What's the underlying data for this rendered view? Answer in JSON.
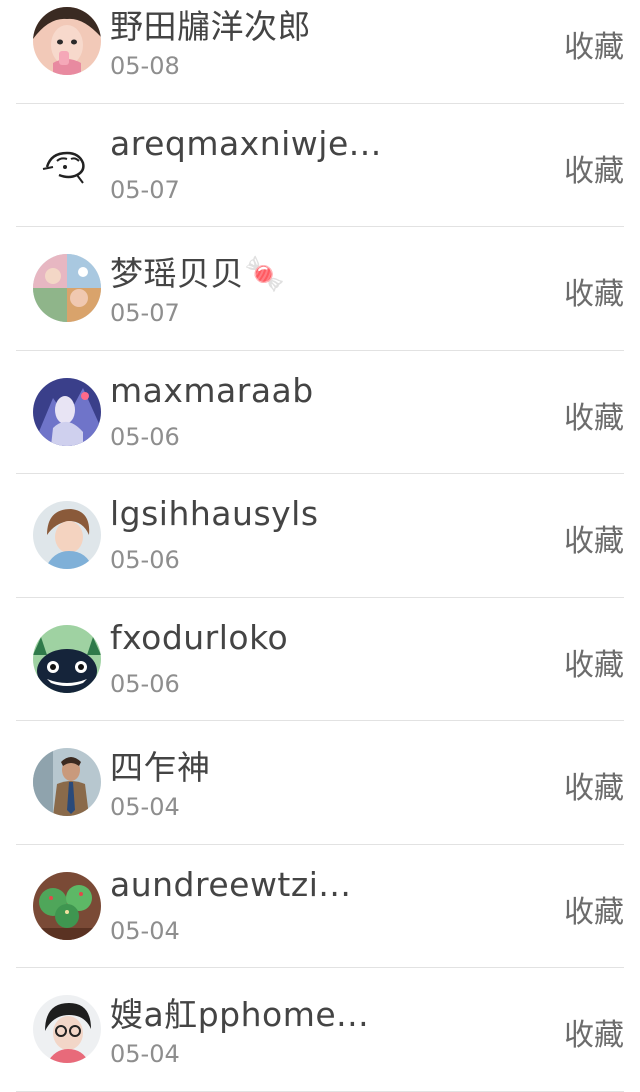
{
  "colors": {
    "name": "#444444",
    "date": "#8e8e8e",
    "action": "#6c6c6c",
    "divider": "#e2e2e2"
  },
  "follow_list": [
    {
      "name": "野田牖洋次郎",
      "date": "05-08",
      "action": "收藏",
      "avatar": "girl-photo-avatar"
    },
    {
      "name": "areqmaxniwje...",
      "date": "05-07",
      "action": "收藏",
      "avatar": "sketch-avatar"
    },
    {
      "name": "梦瑶贝贝🍬",
      "date": "05-07",
      "action": "收藏",
      "avatar": "colorful-collage-avatar"
    },
    {
      "name": "maxmaraab",
      "date": "05-06",
      "action": "收藏",
      "avatar": "anime-art-avatar"
    },
    {
      "name": "lgsihhausyls",
      "date": "05-06",
      "action": "收藏",
      "avatar": "boy-photo-avatar"
    },
    {
      "name": "fxodurloko",
      "date": "05-06",
      "action": "收藏",
      "avatar": "totoro-avatar"
    },
    {
      "name": "四乍神",
      "date": "05-04",
      "action": "收藏",
      "avatar": "man-in-suit-avatar"
    },
    {
      "name": "aundreewtzi...",
      "date": "05-04",
      "action": "收藏",
      "avatar": "cupcake-avatar"
    },
    {
      "name": "嫂a舡pphome...",
      "date": "05-04",
      "action": "收藏",
      "avatar": "glasses-person-avatar"
    }
  ]
}
